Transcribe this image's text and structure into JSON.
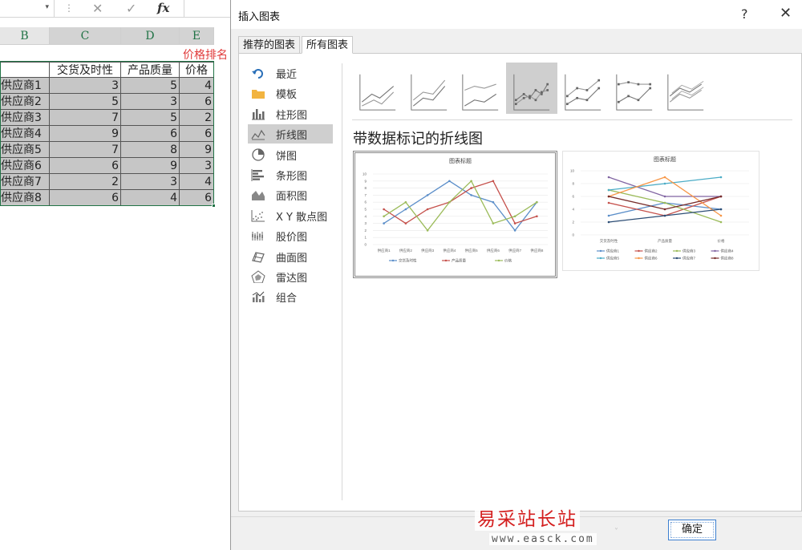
{
  "excel": {
    "formula_bar": {
      "cancel_glyph": "✕",
      "enter_glyph": "✓",
      "fx_label": "fx",
      "separator_glyph": "⋮",
      "namebox_arrow": "▾"
    },
    "columns": [
      {
        "letter": "B",
        "selected": false
      },
      {
        "letter": "C",
        "selected": true
      },
      {
        "letter": "D",
        "selected": true
      },
      {
        "letter": "E",
        "selected": true
      }
    ],
    "rank_label": "价格排名",
    "table_headers": [
      "交货及时性",
      "产品质量",
      "价格"
    ],
    "rows": [
      {
        "name": "供应商1",
        "delivery": 3,
        "quality": 5,
        "price": 4
      },
      {
        "name": "供应商2",
        "delivery": 5,
        "quality": 3,
        "price": 6
      },
      {
        "name": "供应商3",
        "delivery": 7,
        "quality": 5,
        "price": 2
      },
      {
        "name": "供应商4",
        "delivery": 9,
        "quality": 6,
        "price": 6
      },
      {
        "name": "供应商5",
        "delivery": 7,
        "quality": 8,
        "price": 9
      },
      {
        "name": "供应商6",
        "delivery": 6,
        "quality": 9,
        "price": 3
      },
      {
        "name": "供应商7",
        "delivery": 2,
        "quality": 3,
        "price": 4
      },
      {
        "name": "供应商8",
        "delivery": 6,
        "quality": 4,
        "price": 6
      }
    ]
  },
  "dialog": {
    "title": "插入图表",
    "help": "?",
    "close": "✕",
    "tabs": [
      {
        "label": "推荐的图表",
        "active": false
      },
      {
        "label": "所有图表",
        "active": true
      }
    ],
    "chart_types": [
      {
        "label": "最近",
        "icon": "undo-icon"
      },
      {
        "label": "模板",
        "icon": "folder-icon"
      },
      {
        "label": "柱形图",
        "icon": "column-chart-icon"
      },
      {
        "label": "折线图",
        "icon": "line-chart-icon",
        "selected": true
      },
      {
        "label": "饼图",
        "icon": "pie-chart-icon"
      },
      {
        "label": "条形图",
        "icon": "bar-chart-icon"
      },
      {
        "label": "面积图",
        "icon": "area-chart-icon"
      },
      {
        "label": "X Y 散点图",
        "icon": "scatter-chart-icon"
      },
      {
        "label": "股价图",
        "icon": "stock-chart-icon"
      },
      {
        "label": "曲面图",
        "icon": "surface-chart-icon"
      },
      {
        "label": "雷达图",
        "icon": "radar-chart-icon"
      },
      {
        "label": "组合",
        "icon": "combo-chart-icon"
      }
    ],
    "subtypes": [
      {
        "icon": "line-icon"
      },
      {
        "icon": "stacked-line-icon"
      },
      {
        "icon": "percent-stacked-line-icon"
      },
      {
        "icon": "line-with-markers-icon",
        "selected": true
      },
      {
        "icon": "stacked-line-with-markers-icon"
      },
      {
        "icon": "percent-stacked-line-with-markers-icon"
      },
      {
        "icon": "3d-line-icon"
      }
    ],
    "subtype_title": "带数据标记的折线图",
    "ok_label": "确定",
    "faint_text": "˅"
  },
  "previews": [
    {
      "title": "图表标题",
      "categories": [
        "供应商1",
        "供应商2",
        "供应商3",
        "供应商4",
        "供应商5",
        "供应商6",
        "供应商7",
        "供应商8"
      ],
      "y_ticks": [
        "0",
        "1",
        "2",
        "3",
        "4",
        "5",
        "6",
        "7",
        "8",
        "9",
        "10"
      ],
      "series": [
        {
          "name": "交货及时性",
          "color": "#5b8ec9"
        },
        {
          "name": "产品质量",
          "color": "#c5504b"
        },
        {
          "name": "价格",
          "color": "#9bbb59"
        }
      ]
    },
    {
      "title": "图表标题",
      "categories": [
        "交货及时性",
        "产品质量",
        "价格"
      ],
      "y_ticks": [
        "0",
        "2",
        "4",
        "6",
        "8",
        "10"
      ],
      "series": [
        {
          "name": "供应商1",
          "color": "#5b8ec9"
        },
        {
          "name": "供应商2",
          "color": "#c5504b"
        },
        {
          "name": "供应商3",
          "color": "#9bbb59"
        },
        {
          "name": "供应商4",
          "color": "#8064a2"
        },
        {
          "name": "供应商5",
          "color": "#4bacc6"
        },
        {
          "name": "供应商6",
          "color": "#f79646"
        },
        {
          "name": "供应商7",
          "color": "#2c4d75"
        },
        {
          "name": "供应商8",
          "color": "#772c2a"
        }
      ]
    }
  ],
  "watermark": {
    "text": "易采站长站",
    "url": "www.easck.com"
  }
}
